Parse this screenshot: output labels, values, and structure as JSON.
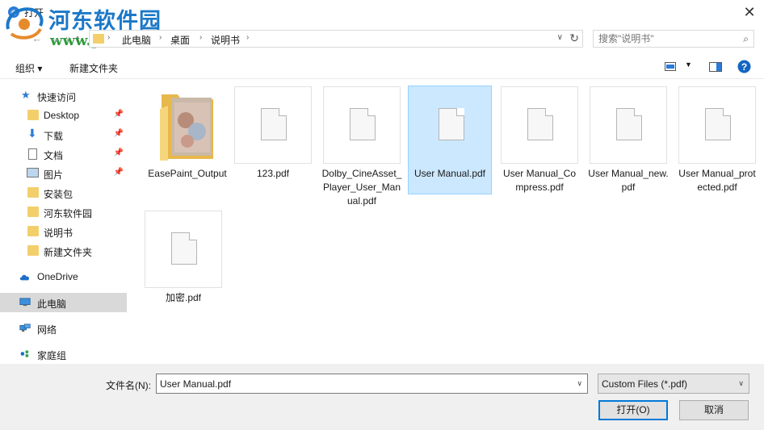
{
  "window": {
    "title": "打开",
    "watermark": "河东软件园",
    "watermark_url": "www.pc0359.cn"
  },
  "addressbar": {
    "breadcrumbs": [
      "此电脑",
      "桌面",
      "说明书"
    ]
  },
  "search": {
    "placeholder": "搜索\"说明书\""
  },
  "toolbar": {
    "organize_label": "组织 ▾",
    "new_folder_label": "新建文件夹"
  },
  "sidebar": {
    "items": [
      {
        "label": "快速访问",
        "icon": "star-icon"
      },
      {
        "label": "Desktop",
        "icon": "folder-icon",
        "pinned": true
      },
      {
        "label": "下载",
        "icon": "download-icon",
        "pinned": true
      },
      {
        "label": "文档",
        "icon": "document-icon",
        "pinned": true
      },
      {
        "label": "图片",
        "icon": "pictures-icon",
        "pinned": true
      },
      {
        "label": "安装包",
        "icon": "folder-icon"
      },
      {
        "label": "河东软件园",
        "icon": "folder-icon"
      },
      {
        "label": "说明书",
        "icon": "folder-icon"
      },
      {
        "label": "新建文件夹",
        "icon": "folder-icon"
      },
      {
        "label": "OneDrive",
        "icon": "cloud-icon"
      },
      {
        "label": "此电脑",
        "icon": "computer-icon",
        "selected": true
      },
      {
        "label": "网络",
        "icon": "network-icon"
      },
      {
        "label": "家庭组",
        "icon": "homegroup-icon"
      }
    ]
  },
  "files": [
    {
      "name": "EasePaint_Output",
      "type": "folder"
    },
    {
      "name": "123.pdf",
      "type": "pdf"
    },
    {
      "name": "Dolby_CineAsset_Player_User_Manual.pdf",
      "type": "pdf"
    },
    {
      "name": "User Manual.pdf",
      "type": "pdf",
      "selected": true
    },
    {
      "name": "User Manual_Compress.pdf",
      "type": "pdf"
    },
    {
      "name": "User Manual_new.pdf",
      "type": "pdf"
    },
    {
      "name": "User Manual_protected.pdf",
      "type": "pdf"
    },
    {
      "name": "加密.pdf",
      "type": "pdf"
    }
  ],
  "footer": {
    "filename_label": "文件名(N):",
    "filename_value": "User Manual.pdf",
    "filetype_value": "Custom Files (*.pdf)",
    "open_label": "打开(O)",
    "cancel_label": "取消"
  },
  "colors": {
    "selection_bg": "#cce8ff",
    "selection_border": "#99d1ff",
    "folder": "#f3cf6c",
    "accent": "#0078d7"
  }
}
